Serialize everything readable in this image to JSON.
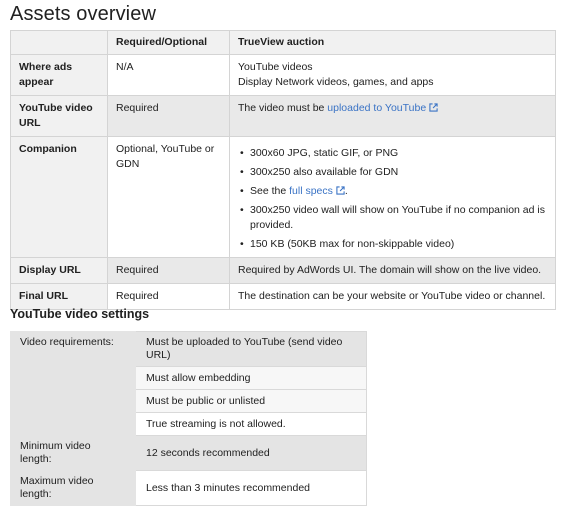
{
  "title": "Assets overview",
  "assets_table": {
    "headers": [
      "",
      "Required/Optional",
      "TrueView auction"
    ],
    "rows": {
      "where_ads": {
        "label": "Where ads appear",
        "req": "N/A",
        "desc_line1": "YouTube videos",
        "desc_line2": "Display Network videos, games, and apps"
      },
      "youtube_url": {
        "label": "YouTube video URL",
        "req": "Required",
        "desc_prefix": "The video must be ",
        "desc_link": "uploaded to YouTube"
      },
      "companion": {
        "label": "Companion",
        "req": "Optional, YouTube or GDN",
        "bullets": {
          "b1": "300x60 JPG, static GIF, or PNG",
          "b2": "300x250 also available for GDN",
          "b3_prefix": "See the ",
          "b3_link": "full specs",
          "b3_suffix": ".",
          "b4": "300x250 video wall will show on YouTube if no companion ad is provided.",
          "b5": "150 KB (50KB max for non-skippable video)"
        }
      },
      "display_url": {
        "label": "Display URL",
        "req": "Required",
        "desc": "Required by AdWords UI. The domain will show on the live video."
      },
      "final_url": {
        "label": "Final URL",
        "req": "Required",
        "desc": "The destination can be your website or YouTube video or channel."
      }
    }
  },
  "settings_title": "YouTube video settings",
  "settings": {
    "video_req_label": "Video requirements:",
    "video_req": [
      "Must be uploaded to YouTube (send video URL)",
      "Must allow embedding",
      "Must be public or unlisted",
      "True streaming is not allowed."
    ],
    "min_label": "Minimum video length:",
    "min_value": "12 seconds recommended",
    "max_label": "Maximum video length:",
    "max_value": "Less than 3 minutes recommended"
  },
  "colors": {
    "link": "#3a73c5",
    "shade": "#e9e9e9",
    "border": "#d4d4d4"
  },
  "icons": {
    "external_link": "external-link-icon"
  }
}
